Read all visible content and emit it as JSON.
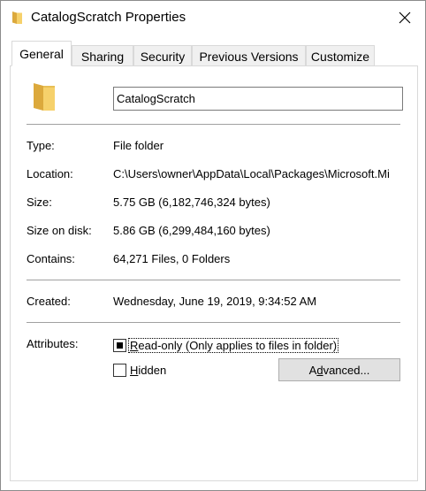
{
  "window": {
    "title": "CatalogScratch Properties",
    "folder_color": "#f0c14b"
  },
  "tabs": [
    {
      "label": "General",
      "active": true
    },
    {
      "label": "Sharing",
      "active": false
    },
    {
      "label": "Security",
      "active": false
    },
    {
      "label": "Previous Versions",
      "active": false
    },
    {
      "label": "Customize",
      "active": false
    }
  ],
  "general": {
    "name_value": "CatalogScratch",
    "type_label": "Type:",
    "type_value": "File folder",
    "location_label": "Location:",
    "location_value": "C:\\Users\\owner\\AppData\\Local\\Packages\\Microsoft.Mi",
    "size_label": "Size:",
    "size_value": "5.75 GB (6,182,746,324 bytes)",
    "size_on_disk_label": "Size on disk:",
    "size_on_disk_value": "5.86 GB (6,299,484,160 bytes)",
    "contains_label": "Contains:",
    "contains_value": "64,271 Files, 0 Folders",
    "created_label": "Created:",
    "created_value": "Wednesday, June 19, 2019, 9:34:52 AM",
    "attributes_label": "Attributes:",
    "readonly_label_pre": "R",
    "readonly_label_rest": "ead-only (Only applies to files in folder)",
    "readonly_state": "indeterminate",
    "hidden_label_pre": "H",
    "hidden_label_rest": "idden",
    "hidden_state": "unchecked",
    "advanced_pre": "A",
    "advanced_u": "d",
    "advanced_rest": "vanced..."
  }
}
